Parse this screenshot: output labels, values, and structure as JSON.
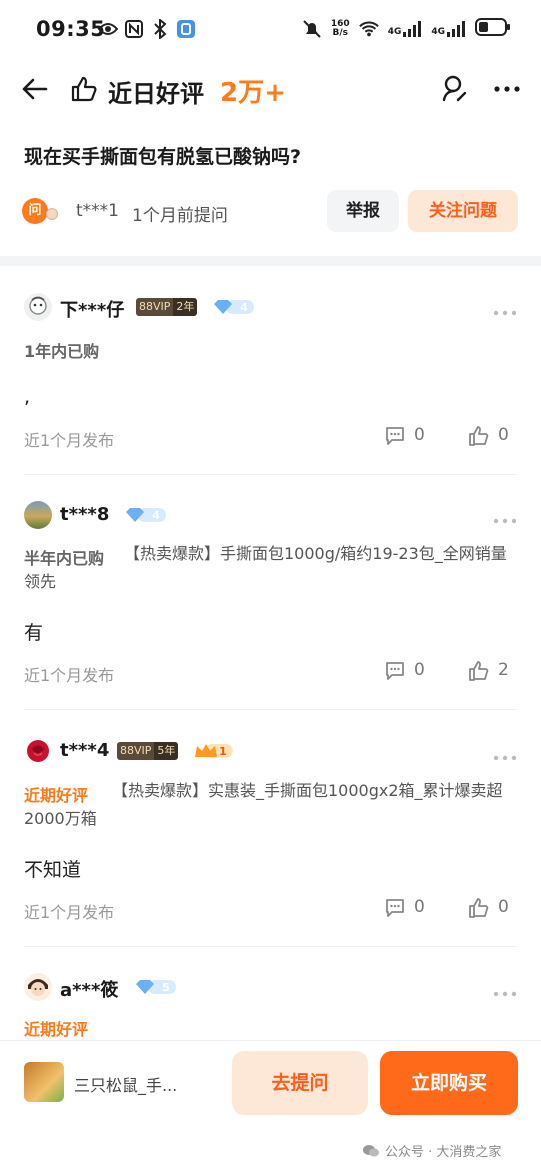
{
  "status_bar": {
    "time": "09:35",
    "net_speed_value": "160",
    "net_speed_unit": "B/s",
    "sim1": "4G",
    "sim2": "4G"
  },
  "header": {
    "title": "近日好评",
    "count": "2万+"
  },
  "question": {
    "text": "现在买手撕面包有脱氢已酸钠吗?",
    "badge": "问",
    "asker": "t***1",
    "asked_time": "1个月前提问",
    "report_label": "举报",
    "follow_label": "关注问题"
  },
  "answers": [
    {
      "name": "下***仔",
      "vip": "88VIP",
      "vip_years": "2年",
      "diamond_level": "4",
      "tag": "1年内已购",
      "sku": "",
      "text": ",",
      "time": "近1个月发布",
      "comments": "0",
      "likes": "0"
    },
    {
      "name": "t***8",
      "diamond_level": "4",
      "tag": "半年内已购",
      "sku": "【热卖爆款】手撕面包1000g/箱约19-23包_全网销量领先",
      "text": "有",
      "time": "近1个月发布",
      "comments": "0",
      "likes": "2"
    },
    {
      "name": "t***4",
      "vip": "88VIP",
      "vip_years": "5年",
      "crown_level": "1",
      "tag": "近期好评",
      "sku": "【热卖爆款】实惠装_手撕面包1000gx2箱_累计爆卖超2000万箱",
      "text": "不知道",
      "time": "近1个月发布",
      "comments": "0",
      "likes": "0"
    },
    {
      "name": "a***筱",
      "diamond_level": "5",
      "tag": "近期好评"
    }
  ],
  "bottom_bar": {
    "product_name": "三只松鼠_手...",
    "ask_label": "去提问",
    "buy_label": "立即购买",
    "watermark": "公众号 · 大消费之家"
  },
  "colors": {
    "accent": "#ff7a1a",
    "buy": "#ff6a1a",
    "diamond": "#6ab0f3"
  }
}
